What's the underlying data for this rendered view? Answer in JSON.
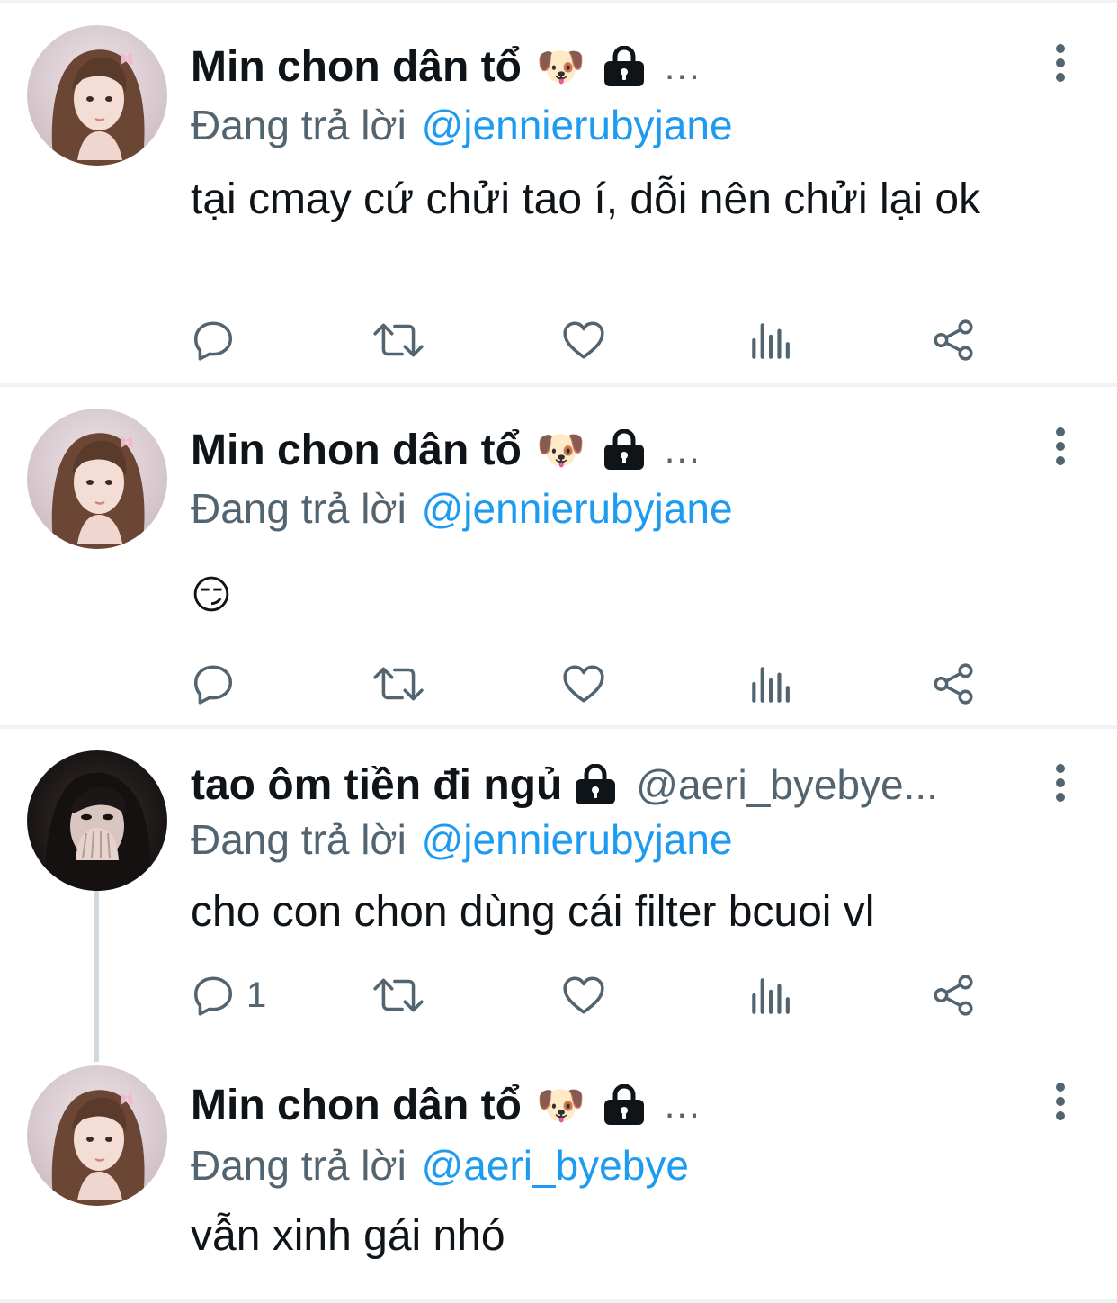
{
  "colors": {
    "accent": "#1d9bf0",
    "secondary_text": "#536471",
    "primary_text": "#0f1419",
    "divider": "#eff3f4"
  },
  "tweets": [
    {
      "author_name": "Min chon dân tổ",
      "name_emoji": "🐶",
      "ellipsis": "...",
      "reply_prefix": "Đang trả lời",
      "reply_to": "@jennierubyjane",
      "text": "tại cmay cứ chửi tao í, dỗi nên chửi lại ok",
      "reply_count": ""
    },
    {
      "author_name": "Min chon dân tổ",
      "name_emoji": "🐶",
      "ellipsis": "...",
      "reply_prefix": "Đang trả lời",
      "reply_to": "@jennierubyjane",
      "text": "😏",
      "reply_count": ""
    },
    {
      "author_name": "tao ôm tiền đi ngủ",
      "handle": "@aeri_byebye...",
      "reply_prefix": "Đang trả lời",
      "reply_to": "@jennierubyjane",
      "text": "cho con chon dùng cái filter bcuoi vl",
      "reply_count": "1"
    },
    {
      "author_name": "Min chon dân tổ",
      "name_emoji": "🐶",
      "ellipsis": "...",
      "reply_prefix": "Đang trả lời",
      "reply_to": "@aeri_byebye",
      "text": "vẫn xinh gái nhó"
    }
  ],
  "icons": [
    "reply-icon",
    "retweet-icon",
    "like-icon",
    "views-icon",
    "share-icon",
    "lock-icon",
    "more-icon"
  ]
}
